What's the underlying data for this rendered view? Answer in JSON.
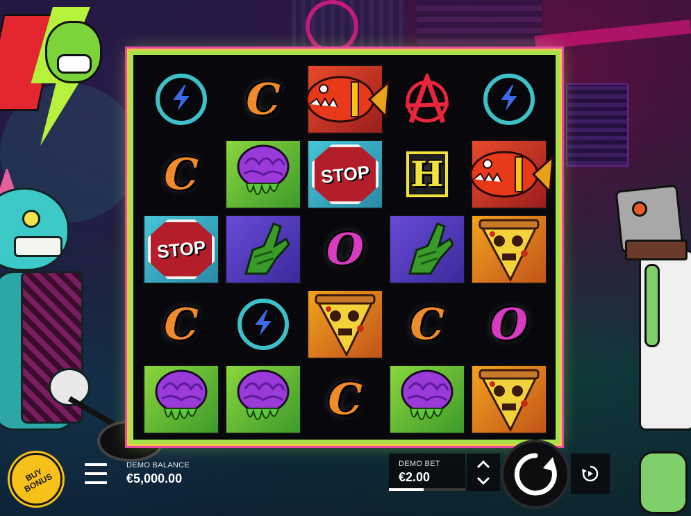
{
  "game": {
    "reels": [
      [
        "bolt",
        "c",
        "fish",
        "anarchy",
        "bolt"
      ],
      [
        "c",
        "brain",
        "stop",
        "h",
        "fish"
      ],
      [
        "stop",
        "hand",
        "o",
        "hand",
        "pizza"
      ],
      [
        "c",
        "bolt",
        "pizza",
        "c",
        "o"
      ],
      [
        "brain",
        "brain",
        "c",
        "brain",
        "pizza"
      ]
    ],
    "symbols": {
      "c": {
        "text": "C",
        "icon": "letter-c-icon",
        "tile": "none"
      },
      "o": {
        "text": "O",
        "icon": "letter-o-icon",
        "tile": "none"
      },
      "h": {
        "text": "H",
        "icon": "letter-h-icon",
        "tile": "none"
      },
      "bolt": {
        "text": "",
        "icon": "lightning-bolt-icon",
        "tile": "none"
      },
      "anarchy": {
        "text": "",
        "icon": "anarchy-icon",
        "tile": "none"
      },
      "stop": {
        "text": "STOP",
        "icon": "stop-sign-icon",
        "tile": "teal"
      },
      "brain": {
        "text": "",
        "icon": "brain-icon",
        "tile": "green"
      },
      "hand": {
        "text": "",
        "icon": "zombie-hand-icon",
        "tile": "purple"
      },
      "pizza": {
        "text": "",
        "icon": "pizza-slice-icon",
        "tile": "orange"
      },
      "fish": {
        "text": "",
        "icon": "piranha-fish-icon",
        "tile": "red"
      }
    }
  },
  "controls": {
    "buy_bonus_label": "BUY\nBONUS",
    "balance_label": "DEMO BALANCE",
    "balance_value": "€5,000.00",
    "bet_label": "DEMO BET",
    "bet_value": "€2.00",
    "bet_level_fraction": 0.45,
    "menu_icon": "hamburger-menu-icon",
    "spin_icon": "spin-arrow-icon",
    "autoplay_icon": "autoplay-icon",
    "bet_up_icon": "chevron-up-icon",
    "bet_down_icon": "chevron-down-icon"
  },
  "colors": {
    "frame": "#a8e24a",
    "buy_bonus": "#f6c21a",
    "stop_red": "#b41e2a"
  }
}
